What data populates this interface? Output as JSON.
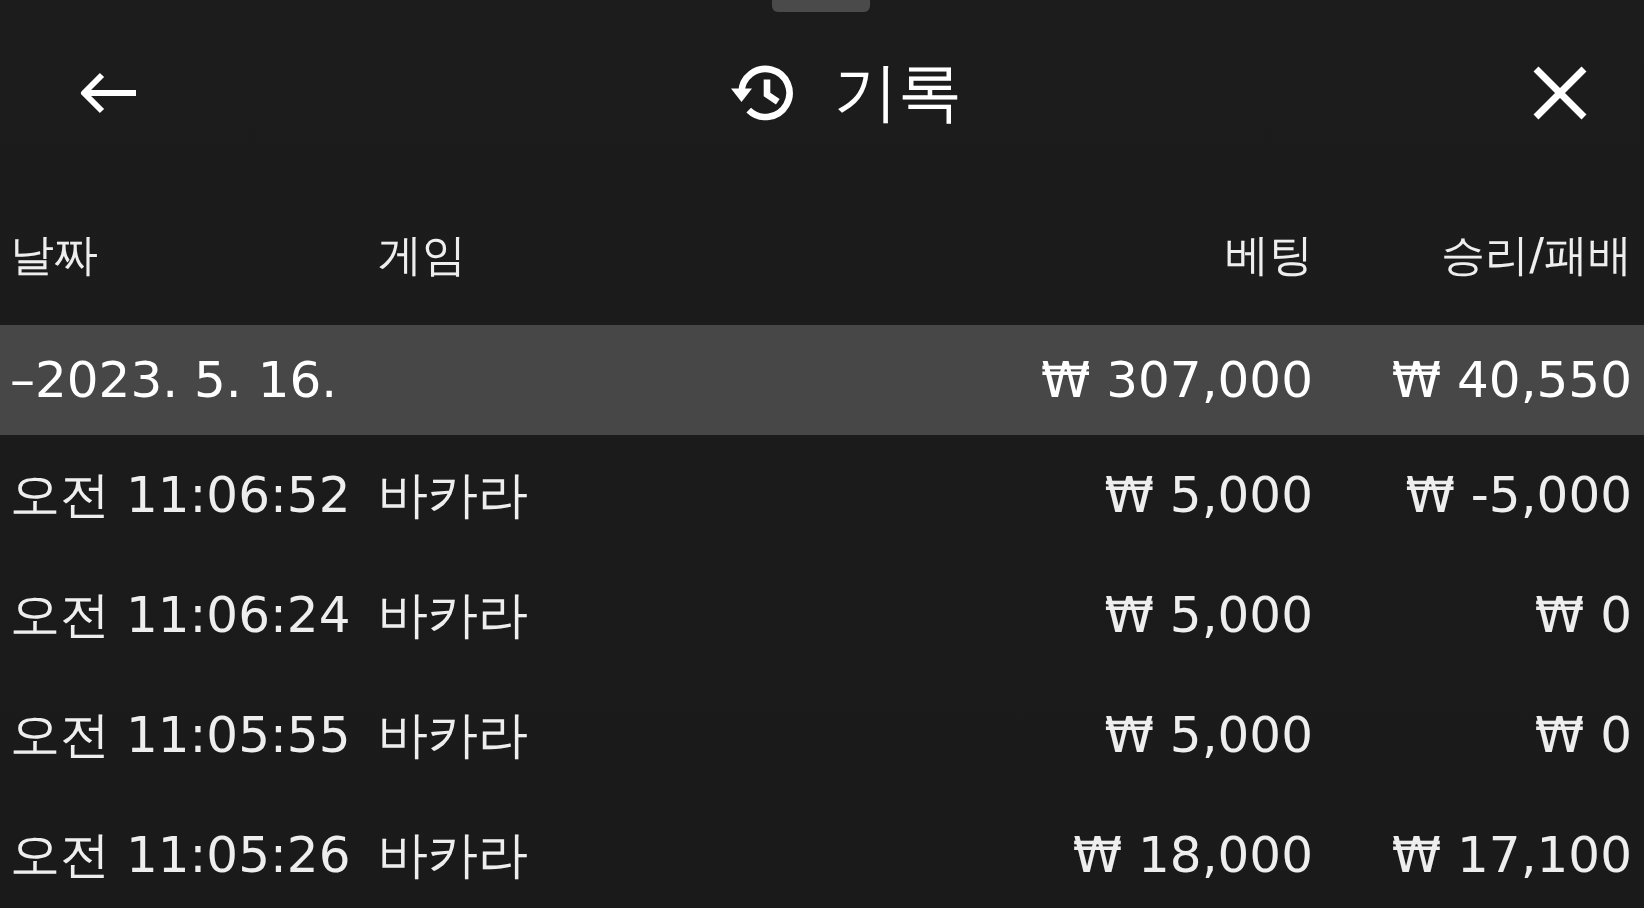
{
  "header": {
    "title": "기록"
  },
  "table": {
    "columns": [
      "날짜",
      "게임",
      "베팅",
      "승리/패배"
    ],
    "group": {
      "date": "–2023. 5. 16.",
      "bet": "₩ 307,000",
      "result": "₩ 40,550"
    },
    "rows": [
      {
        "time": "오전 11:06:52",
        "game": "바카라",
        "bet": "₩ 5,000",
        "result": "₩ -5,000"
      },
      {
        "time": "오전 11:06:24",
        "game": "바카라",
        "bet": "₩ 5,000",
        "result": "₩ 0"
      },
      {
        "time": "오전 11:05:55",
        "game": "바카라",
        "bet": "₩ 5,000",
        "result": "₩ 0"
      },
      {
        "time": "오전 11:05:26",
        "game": "바카라",
        "bet": "₩ 18,000",
        "result": "₩ 17,100"
      }
    ]
  }
}
